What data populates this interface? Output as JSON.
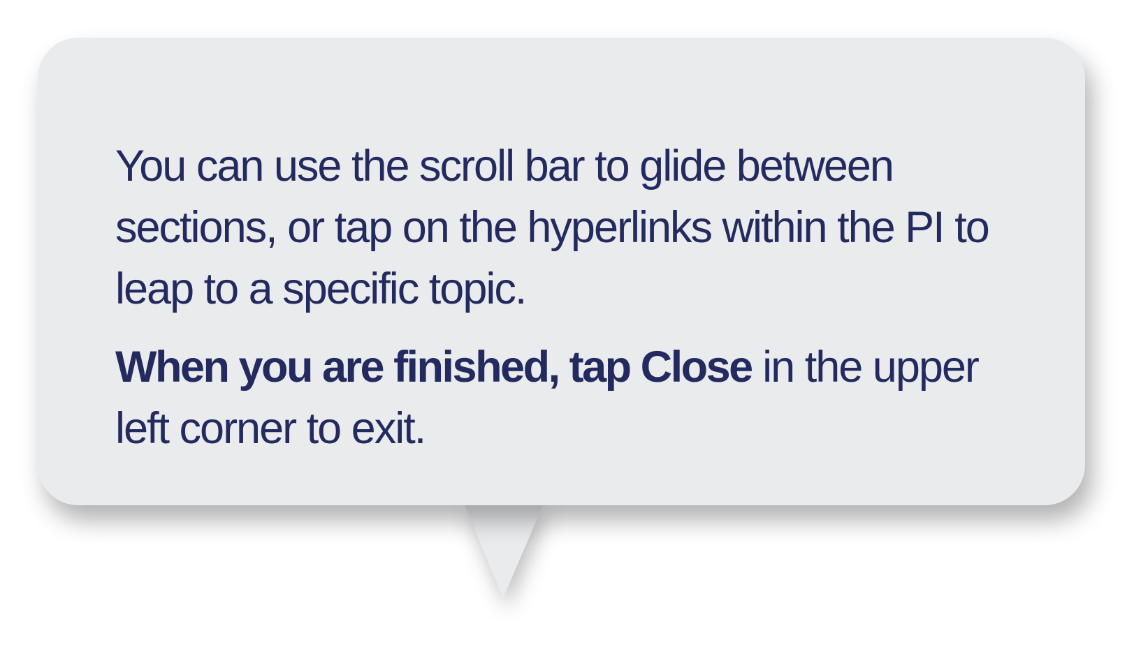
{
  "tooltip": {
    "paragraph_1": "You can use the scroll bar to glide between sections, or tap on the hyperlinks within the PI to leap to a specific topic.",
    "paragraph_2_bold": "When you are finished, tap Close",
    "paragraph_2_rest": " in the upper left corner to exit."
  },
  "colors": {
    "bubble_background": "#eaebed",
    "text": "#232a5f",
    "page_background": "#ffffff"
  }
}
